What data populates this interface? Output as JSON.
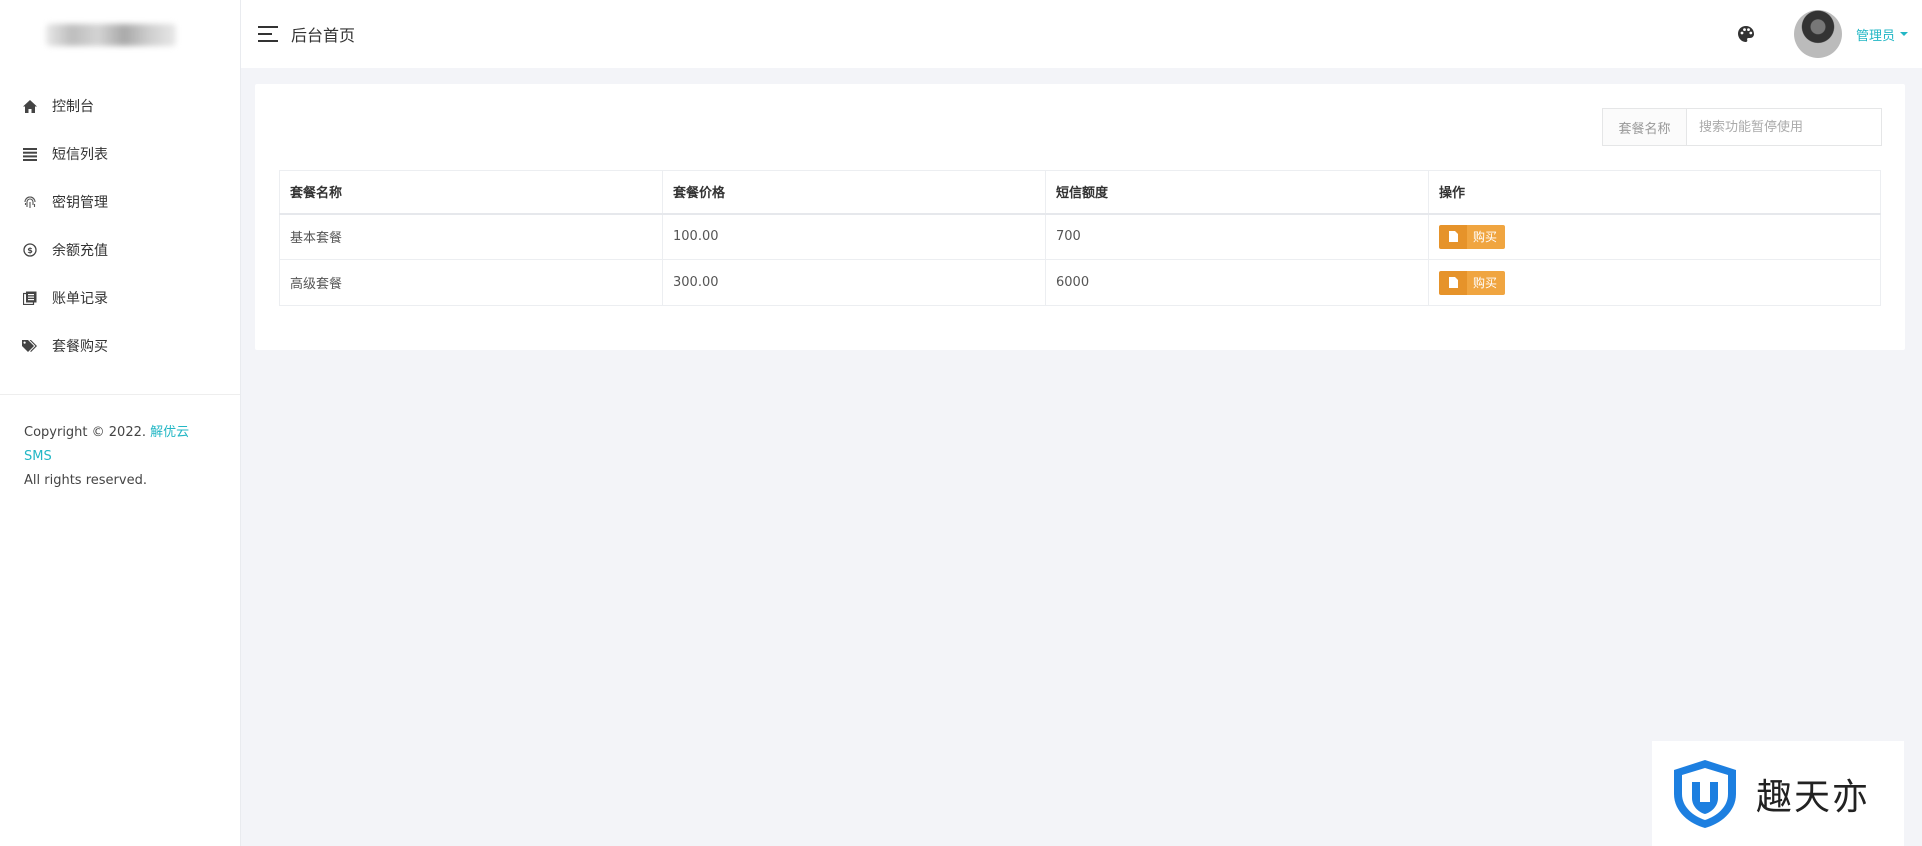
{
  "sidebar": {
    "items": [
      {
        "label": "控制台",
        "icon": "home-icon"
      },
      {
        "label": "短信列表",
        "icon": "list-icon"
      },
      {
        "label": "密钥管理",
        "icon": "fingerprint-icon"
      },
      {
        "label": "余额充值",
        "icon": "dollar-circle-icon"
      },
      {
        "label": "账单记录",
        "icon": "book-icon"
      },
      {
        "label": "套餐购买",
        "icon": "tags-icon"
      }
    ],
    "copyright_prefix": "Copyright © 2022. ",
    "copyright_brand": "解优云SMS",
    "copyright_suffix": "All rights reserved."
  },
  "header": {
    "title": "后台首页",
    "user_name": "管理员"
  },
  "search": {
    "label": "套餐名称",
    "placeholder": "搜索功能暂停使用"
  },
  "table": {
    "headers": [
      "套餐名称",
      "套餐价格",
      "短信额度",
      "操作"
    ],
    "rows": [
      {
        "name": "基本套餐",
        "price": "100.00",
        "quota": "700",
        "action": "购买"
      },
      {
        "name": "高级套餐",
        "price": "300.00",
        "quota": "6000",
        "action": "购买"
      }
    ]
  },
  "watermark": {
    "text": "趣天亦"
  },
  "colors": {
    "accent": "#23b7c5",
    "buy_button": "#f0a540",
    "buy_button_icon": "#e6932a",
    "background": "#f3f4f8"
  }
}
